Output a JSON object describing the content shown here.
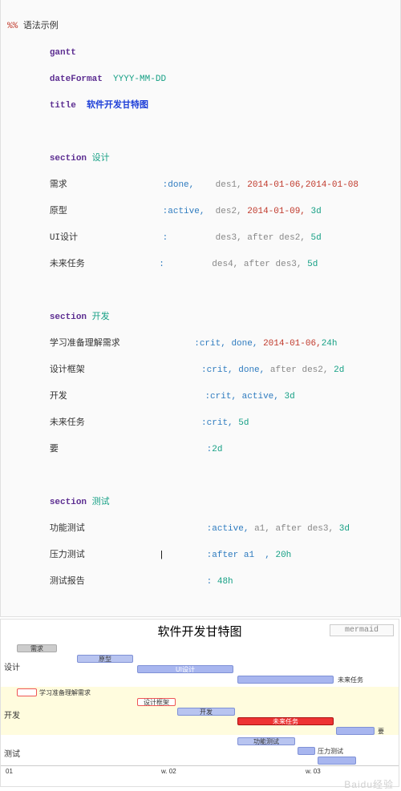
{
  "header_directive": "%%",
  "header_text": "语法示例",
  "code": {
    "kw_gantt": "gantt",
    "kw_datefmt": "dateFormat",
    "datefmt_val": "YYYY-MM-DD",
    "kw_title": "title",
    "title_val": "软件开发甘特图",
    "sec_kw": "section",
    "sec1": "设计",
    "sec2": "开发",
    "sec3": "测试",
    "rows": {
      "s1r1_name": "需求",
      "s1r1_attr": ":done,",
      "s1r1_id": "des1,",
      "s1r1_d1": "2014-01-06,",
      "s1r1_d2": "2014-01-08",
      "s1r2_name": "原型",
      "s1r2_attr": ":active,",
      "s1r2_id": "des2,",
      "s1r2_d1": "2014-01-09,",
      "s1r2_d2": "3d",
      "s1r3_name": "UI设计",
      "s1r3_attr": ":",
      "s1r3_id": "des3,",
      "s1r3_after": "after des2,",
      "s1r3_dur": "5d",
      "s1r4_name": "未来任务",
      "s1r4_attr": ":",
      "s1r4_id": "des4,",
      "s1r4_after": "after des3,",
      "s1r4_dur": "5d",
      "s2r1_name": "学习准备理解需求",
      "s2r1_attr": ":crit, done,",
      "s2r1_d1": "2014-01-06,",
      "s2r1_dur": "24h",
      "s2r2_name": "设计框架",
      "s2r2_attr": ":crit, done,",
      "s2r2_after": "after des2,",
      "s2r2_dur": "2d",
      "s2r3_name": "开发",
      "s2r3_attr": ":crit, active,",
      "s2r3_dur": "3d",
      "s2r4_name": "未来任务",
      "s2r4_attr": ":crit,",
      "s2r4_dur": "5d",
      "s2r5_name": "要",
      "s2r5_attr": ":",
      "s2r5_dur": "2d",
      "s3r1_name": "功能测试",
      "s3r1_attr": ":active,",
      "s3r1_id": "a1,",
      "s3r1_after": "after des3,",
      "s3r1_dur": "3d",
      "s3r2_name": "压力测试",
      "s3r2_attr": ":after a1  ,",
      "s3r2_dur": "20h",
      "s3r3_name": "测试报告",
      "s3r3_attr": ":",
      "s3r3_dur": "48h"
    }
  },
  "chart_data": {
    "type": "gantt",
    "title": "软件开发甘特图",
    "renderer": "mermaid",
    "dateFormat": "YYYY-MM-DD",
    "axis_labels": [
      "01",
      "w. 02",
      "w. 03"
    ],
    "sections": [
      {
        "name": "设计",
        "tasks": [
          {
            "name": "需求",
            "status": "done",
            "id": "des1",
            "start": "2014-01-06",
            "end": "2014-01-08"
          },
          {
            "name": "原型",
            "status": "active",
            "id": "des2",
            "start": "2014-01-09",
            "duration": "3d"
          },
          {
            "name": "UI设计",
            "status": "future",
            "id": "des3",
            "after": "des2",
            "duration": "5d"
          },
          {
            "name": "未来任务",
            "status": "future",
            "id": "des4",
            "after": "des3",
            "duration": "5d"
          }
        ]
      },
      {
        "name": "开发",
        "tasks": [
          {
            "name": "学习准备理解需求",
            "status": "crit-done",
            "start": "2014-01-06",
            "duration": "24h"
          },
          {
            "name": "设计框架",
            "status": "crit-done",
            "after": "des2",
            "duration": "2d"
          },
          {
            "name": "开发",
            "status": "crit-active",
            "duration": "3d"
          },
          {
            "name": "未来任务",
            "status": "crit",
            "duration": "5d"
          },
          {
            "name": "要",
            "status": "future",
            "duration": "2d"
          }
        ]
      },
      {
        "name": "测试",
        "tasks": [
          {
            "name": "功能测试",
            "status": "active",
            "id": "a1",
            "after": "des3",
            "duration": "3d"
          },
          {
            "name": "压力测试",
            "status": "future",
            "after": "a1",
            "duration": "20h"
          },
          {
            "name": "测试报告",
            "status": "future",
            "duration": "48h"
          }
        ]
      }
    ]
  },
  "watermark": "Baidu经验"
}
